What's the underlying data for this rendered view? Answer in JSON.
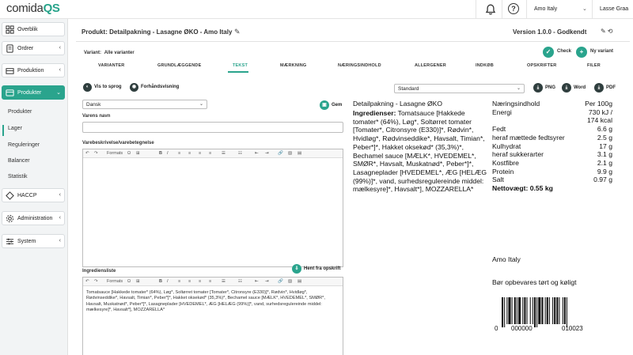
{
  "app": {
    "logo_main": "comida",
    "logo_qs": "QS"
  },
  "topbar": {
    "company": "Amo Italy",
    "user": "Lasse Graa",
    "icons": [
      "bell-icon",
      "help-icon"
    ]
  },
  "sidebar": {
    "items": [
      {
        "label": "Overblik",
        "icon": "dashboard-icon"
      },
      {
        "label": "Ordrer",
        "icon": "orders-icon"
      },
      {
        "label": "Produktion",
        "icon": "production-icon"
      },
      {
        "label": "Produkter",
        "icon": "products-icon",
        "active": true
      },
      {
        "label": "HACCP",
        "icon": "haccp-icon"
      },
      {
        "label": "Administration",
        "icon": "gear-icon"
      },
      {
        "label": "System",
        "icon": "sliders-icon"
      }
    ],
    "subitems": [
      "Produkter",
      "Lager",
      "Reguleringer",
      "Balancer",
      "Statistik"
    ]
  },
  "header": {
    "title": "Produkt: Detailpakning - Lasagne ØKO - Amo Italy",
    "version": "Version 1.0.0 - Godkendt"
  },
  "variant": {
    "label": "Variant:",
    "value": "Alle varianter"
  },
  "actions": {
    "check": "Check",
    "new_variant": "Ny variant"
  },
  "tabs": [
    "VARIANTER",
    "GRUNDLÆGGENDE",
    "TEKST",
    "MÆRKNING",
    "NÆRINGSINDHOLD",
    "ALLERGENER",
    "INDKØB",
    "OPSKRIFTER",
    "FILER"
  ],
  "active_tab": "TEKST",
  "text_tab": {
    "show_language": "Vis to sprog",
    "preview": "Forhåndsvisning",
    "language": "Dansk",
    "save": "Gem",
    "name_label": "Varens navn",
    "name_value": "",
    "description_label": "Varebeskrivelse/varebetegnelse",
    "description_value": "",
    "formats": "Formats",
    "ingredients_label": "Ingrediensliste",
    "fetch_recipe": "Hent fra opskrift",
    "ingredients_value": "Tomatsauce [Hakkede tomater* (64%), Løg*, Soltørret tomater [Tomater*, Citronsyre (E330)]*, Rødvin*, Hvidløg*, Rødvinseddike*, Havsalt, Timian*, Peber*]*, Hakket oksekød* (35,3%)*, Bechamel sauce [MÆLK*, HVEDEMEL*, SMØR*, Havsalt, Muskatnød*, Peber*]*, Lasagneplader [HVEDEMEL*, ÆG [HELÆG (99%)]*, vand, surhedsregulereinde middel: mælkesyre]*, Havsalt*], MOZZARELLA*"
  },
  "preview": {
    "template": "Standard",
    "export_png": "PNG",
    "export_word": "Word",
    "export_pdf": "PDF"
  },
  "label": {
    "title": "Detailpakning - Lasagne ØKO",
    "ingredients_heading": "Ingredienser:",
    "ingredients_text": " Tomatsauce [Hakkede tomater* (64%), Løg*, Soltørret tomater [Tomater*, Citronsyre (E330)]*, Rødvin*, Hvidløg*, Rødvinseddike*, Havsalt, Timian*, Peber*]*, Hakket oksekød* (35,3%)*, Bechamel sauce [MÆLK*, HVEDEMEL*, SMØR*, Havsalt, Muskatnød*, Peber*]*, Lasagneplader [HVEDEMEL*, ÆG [HELÆG (99%)]*, vand, surhedsregulereinde middel: mælkesyre]*, Havsalt*], MOZZARELLA*",
    "nutrition": [
      {
        "label": "Næringsindhold",
        "value": "Per 100g"
      },
      {
        "label": "Energi",
        "value": "730 kJ /"
      },
      {
        "label": "",
        "value": "174 kcal"
      },
      {
        "label": "Fedt",
        "value": "6.6 g"
      },
      {
        "label": "heraf mættede fedtsyrer",
        "value": "2.5 g"
      },
      {
        "label": "Kulhydrat",
        "value": "17 g"
      },
      {
        "label": "heraf sukkerarter",
        "value": "3.1 g"
      },
      {
        "label": "Kostfibre",
        "value": "2.1 g"
      },
      {
        "label": "Protein",
        "value": "9.9 g"
      },
      {
        "label": "Salt",
        "value": "0.97 g"
      }
    ],
    "net_weight": "Nettovægt: 0.55 kg",
    "brand": "Amo Italy",
    "storage": "Bør opbevares tørt og køligt",
    "barcode": {
      "d1": "0",
      "d2": "000000",
      "d3": "010023"
    }
  },
  "colors": {
    "accent": "#2aa48d",
    "dark_button": "#2f3e3e"
  }
}
